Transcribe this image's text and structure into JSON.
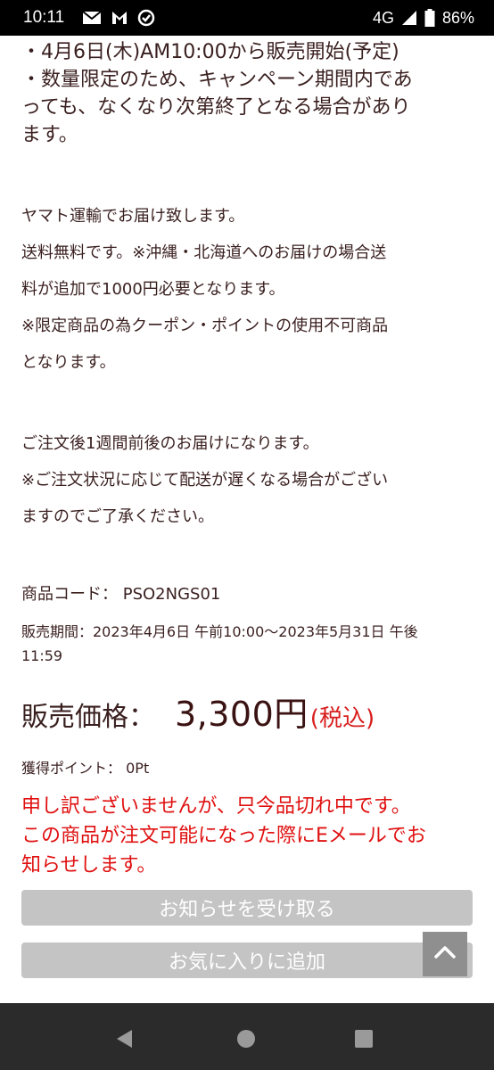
{
  "status_bar": {
    "time": "10:11",
    "network": "4G",
    "battery": "86%",
    "icons_left": [
      "mail-icon",
      "gmail-icon",
      "check-circle-icon"
    ],
    "icons_right": [
      "signal-icon",
      "battery-icon"
    ]
  },
  "notices": {
    "line1": "・4月6日(木)AM10:00から販売開始(予定)",
    "line2": "・数量限定のため、キャンペーン期間内であ",
    "line3": "っても、なくなり次第終了となる場合があり",
    "line4": "ます。"
  },
  "shipping": {
    "line1": "ヤマト運輸でお届け致します。",
    "line2": "送料無料です。※沖縄・北海道へのお届けの場合送",
    "line3": "料が追加で1000円必要となります。",
    "line4": "※限定商品の為クーポン・ポイントの使用不可商品",
    "line5": "となります。"
  },
  "delivery": {
    "line1": "ご注文後1週間前後のお届けになります。",
    "line2": "※ご注文状況に応じて配送が遅くなる場合がござい",
    "line3": "ますのでご了承ください。"
  },
  "product": {
    "code_label": "商品コード：",
    "code_value": "PSO2NGS01",
    "period_line1": "販売期間：2023年4月6日 午前10:00～2023年5月31日 午後",
    "period_line2": "11:59",
    "price_label": "販売価格：",
    "price_value": "3,300円",
    "price_tax": "(税込)",
    "points_label": "獲得ポイント：",
    "points_value": "0Pt"
  },
  "soldout": {
    "line1": "申し訳ございませんが、只今品切れ中です。",
    "line2": "この商品が注文可能になった際にEメールでお",
    "line3": "知らせします。"
  },
  "buttons": {
    "notify": "お知らせを受け取る",
    "favorite": "お気に入りに追加"
  },
  "colors": {
    "text": "#3a1f1f",
    "alert": "#e01010",
    "tax": "#d81e1e",
    "button": "#c4c4c4"
  }
}
